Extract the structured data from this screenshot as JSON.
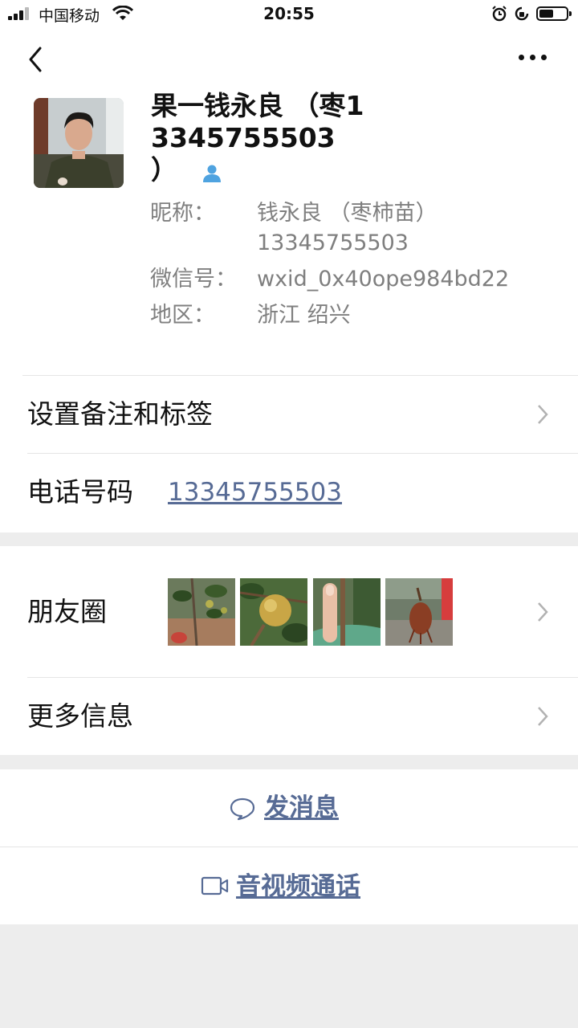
{
  "status_bar": {
    "carrier": "中国移动",
    "time": "20:55",
    "icons": [
      "signal-icon",
      "wifi-icon",
      "alarm-icon",
      "orientation-lock-icon",
      "battery-icon"
    ]
  },
  "profile": {
    "display_name": "果一钱永良 （枣13345755503",
    "display_name_tail": "）",
    "gender_icon": "male-icon",
    "nickname_label": "昵称：",
    "nickname_value_line1": "钱永良 （枣柿苗）",
    "nickname_value_line2": "13345755503",
    "wechat_id_label": "微信号：",
    "wechat_id_value": "wxid_0x40ope984bd22",
    "region_label": "地区：",
    "region_value": "浙江 绍兴"
  },
  "rows": {
    "remark_tags": "设置备注和标签",
    "phone_label": "电话号码",
    "phone_value": "13345755503",
    "moments_label": "朋友圈",
    "more_info": "更多信息"
  },
  "actions": {
    "send_message": "发消息",
    "video_call": "音视频通话"
  },
  "colors": {
    "link": "#576b95",
    "background": "#ededed",
    "surface": "#ffffff"
  }
}
